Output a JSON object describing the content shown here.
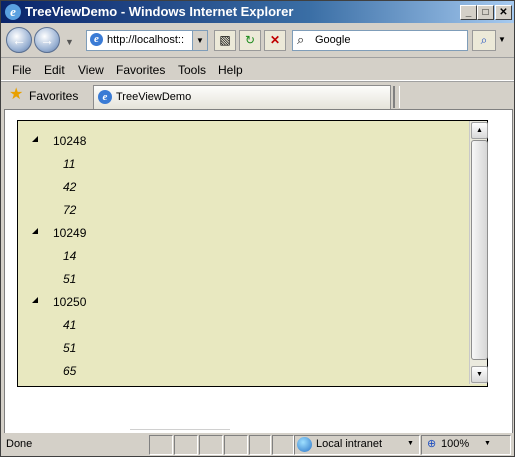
{
  "window": {
    "title": "TreeViewDemo - Windows Internet Explorer",
    "controls": {
      "minimize": "_",
      "maximize": "□",
      "close": "✕"
    }
  },
  "address_bar": {
    "url": "http://localhost::",
    "search_placeholder": "Google"
  },
  "menu": {
    "items": [
      "File",
      "Edit",
      "View",
      "Favorites",
      "Tools",
      "Help"
    ]
  },
  "favorites_bar": {
    "favorites_label": "Favorites",
    "tab_title": "TreeViewDemo"
  },
  "tree": {
    "nodes": [
      {
        "label": "10248",
        "expanded": true,
        "children": [
          "11",
          "42",
          "72"
        ]
      },
      {
        "label": "10249",
        "expanded": true,
        "children": [
          "14",
          "51"
        ]
      },
      {
        "label": "10250",
        "expanded": true,
        "children": [
          "41",
          "51",
          "65"
        ]
      }
    ]
  },
  "status_bar": {
    "status": "Done",
    "zone": "Local intranet",
    "zoom": "100%"
  },
  "icons": {
    "back": "back-arrow-icon",
    "forward": "forward-arrow-icon",
    "refresh": "refresh-icon",
    "stop": "stop-icon",
    "search": "search-icon",
    "favorites": "star-icon",
    "zone": "globe-icon",
    "zoom": "zoom-icon"
  },
  "colors": {
    "tree_background": "#e8e8c0",
    "title_bar": "#0a246a"
  }
}
